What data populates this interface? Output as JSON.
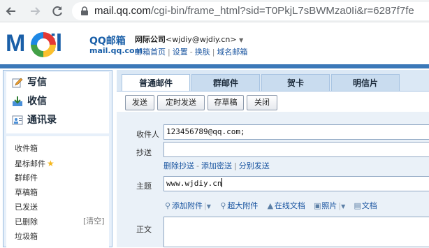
{
  "browser": {
    "url_host": "mail.qq.com",
    "url_path": "/cgi-bin/frame_html?sid=T0PkjL7sBWMza0Ii&r=6287f7fe"
  },
  "header": {
    "logo_text": "M◯il",
    "brand": "QQ邮箱",
    "domain": "mail.qq.com",
    "account_company": "网际公司",
    "account_email": "<wjdiy@wjdiy.cn>",
    "links": [
      "邮箱首页",
      "设置",
      "换肤",
      "域名邮箱"
    ]
  },
  "sidebar": {
    "nav": [
      {
        "label": "写信",
        "icon": "pencil-icon"
      },
      {
        "label": "收信",
        "icon": "inbox-download-icon"
      },
      {
        "label": "通讯录",
        "icon": "contacts-card-icon"
      }
    ],
    "folders": [
      "收件箱",
      "星标邮件",
      "群邮件",
      "草稿箱",
      "已发送",
      "已删除",
      "垃圾箱"
    ],
    "clear_label": "[清空]"
  },
  "tabs": [
    "普通邮件",
    "群邮件",
    "贺卡",
    "明信片"
  ],
  "toolbar": {
    "send": "发送",
    "timed_send": "定时发送",
    "save_draft": "存草稿",
    "close": "关闭"
  },
  "compose": {
    "to_label": "收件人",
    "to_value": "123456789@qq.com;",
    "cc_label": "抄送",
    "cc_value": "",
    "cc_options": [
      "删除抄送",
      "添加密送",
      "分别发送"
    ],
    "subject_label": "主题",
    "subject_value": "www.wjdiy.cn",
    "attachments": [
      "添加附件",
      "超大附件",
      "在线文档",
      "照片",
      "文档"
    ],
    "body_label": "正文"
  },
  "colors": {
    "brand_blue": "#1a5fa8",
    "top_line": "#3b78b8",
    "link_blue": "#1a55a0",
    "star": "#f5b71e"
  }
}
